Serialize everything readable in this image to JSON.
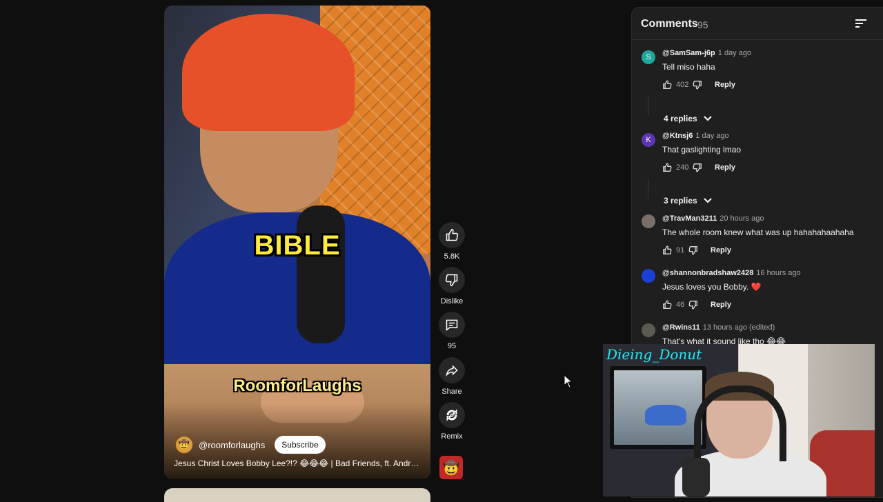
{
  "video": {
    "caption_word": "BIBLE",
    "watermark": "RoomforLaughs",
    "channel_avatar": "🤠",
    "channel_handle": "@roomforlaughs",
    "subscribe_label": "Subscribe",
    "title": "Jesus Christ Loves Bobby Lee?!? 😂😂😂 | Bad Friends, ft. Andre..."
  },
  "actions": {
    "like_count": "5.8K",
    "dislike_label": "Dislike",
    "comment_count": "95",
    "share_label": "Share",
    "remix_label": "Remix",
    "channel_avatar": "🤠"
  },
  "comments_panel": {
    "title": "Comments",
    "count": "95",
    "items": [
      {
        "avatar_letter": "S",
        "avatar_color": "#1ea89b",
        "author": "@SamSam-j6p",
        "time": "1 day ago",
        "text": "Tell miso haha",
        "likes": "402",
        "reply_label": "Reply",
        "replies": "4 replies"
      },
      {
        "avatar_letter": "K",
        "avatar_color": "#5e35b1",
        "author": "@Ktnsj6",
        "time": "1 day ago",
        "text": "That gaslighting lmao",
        "likes": "240",
        "reply_label": "Reply",
        "replies": "3 replies"
      },
      {
        "avatar_letter": "",
        "avatar_color": "#7a6f66",
        "author": "@TravMan3211",
        "time": "20 hours ago",
        "text": "The whole room knew what was up hahahahaahaha",
        "likes": "91",
        "reply_label": "Reply"
      },
      {
        "avatar_letter": "",
        "avatar_color": "#1c3fd6",
        "author": "@shannonbradshaw2428",
        "time": "16 hours ago",
        "text": "Jesus loves you Bobby. ❤️",
        "likes": "46",
        "reply_label": "Reply"
      },
      {
        "avatar_letter": "",
        "avatar_color": "#5b5b4f",
        "author": "@Rwins11",
        "time": "13 hours ago (edited)",
        "text": "That's what it sound like tho 😂😂"
      }
    ]
  },
  "webcam": {
    "streamer_tag": "Dieing_Donut"
  }
}
